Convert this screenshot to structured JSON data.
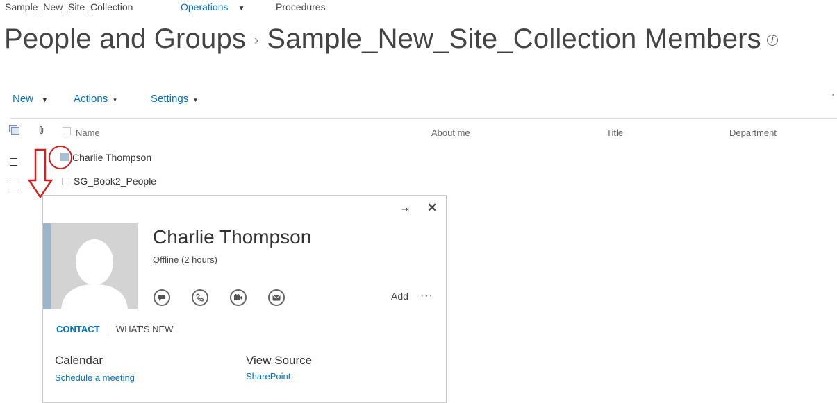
{
  "top_nav": {
    "site": "Sample_New_Site_Collection",
    "operations": "Operations",
    "procedures": "Procedures"
  },
  "page_title": {
    "parent": "People and Groups",
    "separator": "›",
    "current": "Sample_New_Site_Collection Members",
    "info_glyph": "i"
  },
  "toolbar": {
    "new": "New",
    "actions": "Actions",
    "settings": "Settings",
    "caret": "▾"
  },
  "columns": [
    "Name",
    "About me",
    "Title",
    "Department"
  ],
  "rows": [
    {
      "name": "Charlie Thompson"
    },
    {
      "name": "SG_Book2_People"
    }
  ],
  "contact_card": {
    "name": "Charlie Thompson",
    "status": "Offline (2 hours)",
    "add": "Add",
    "more": "···",
    "pin": "⇥",
    "close": "✕",
    "tabs": {
      "contact": "CONTACT",
      "whats_new": "WHAT'S NEW"
    },
    "calendar_label": "Calendar",
    "calendar_link": "Schedule a meeting",
    "view_source_label": "View Source",
    "view_source_link": "SharePoint",
    "icons": [
      "chat-icon",
      "phone-icon",
      "video-icon",
      "email-icon"
    ]
  },
  "colors": {
    "accent": "#0072c6",
    "annotation_red": "#d21f1f",
    "avatar_bg": "#d3d3d3",
    "stripe": "#9cb5c9"
  }
}
